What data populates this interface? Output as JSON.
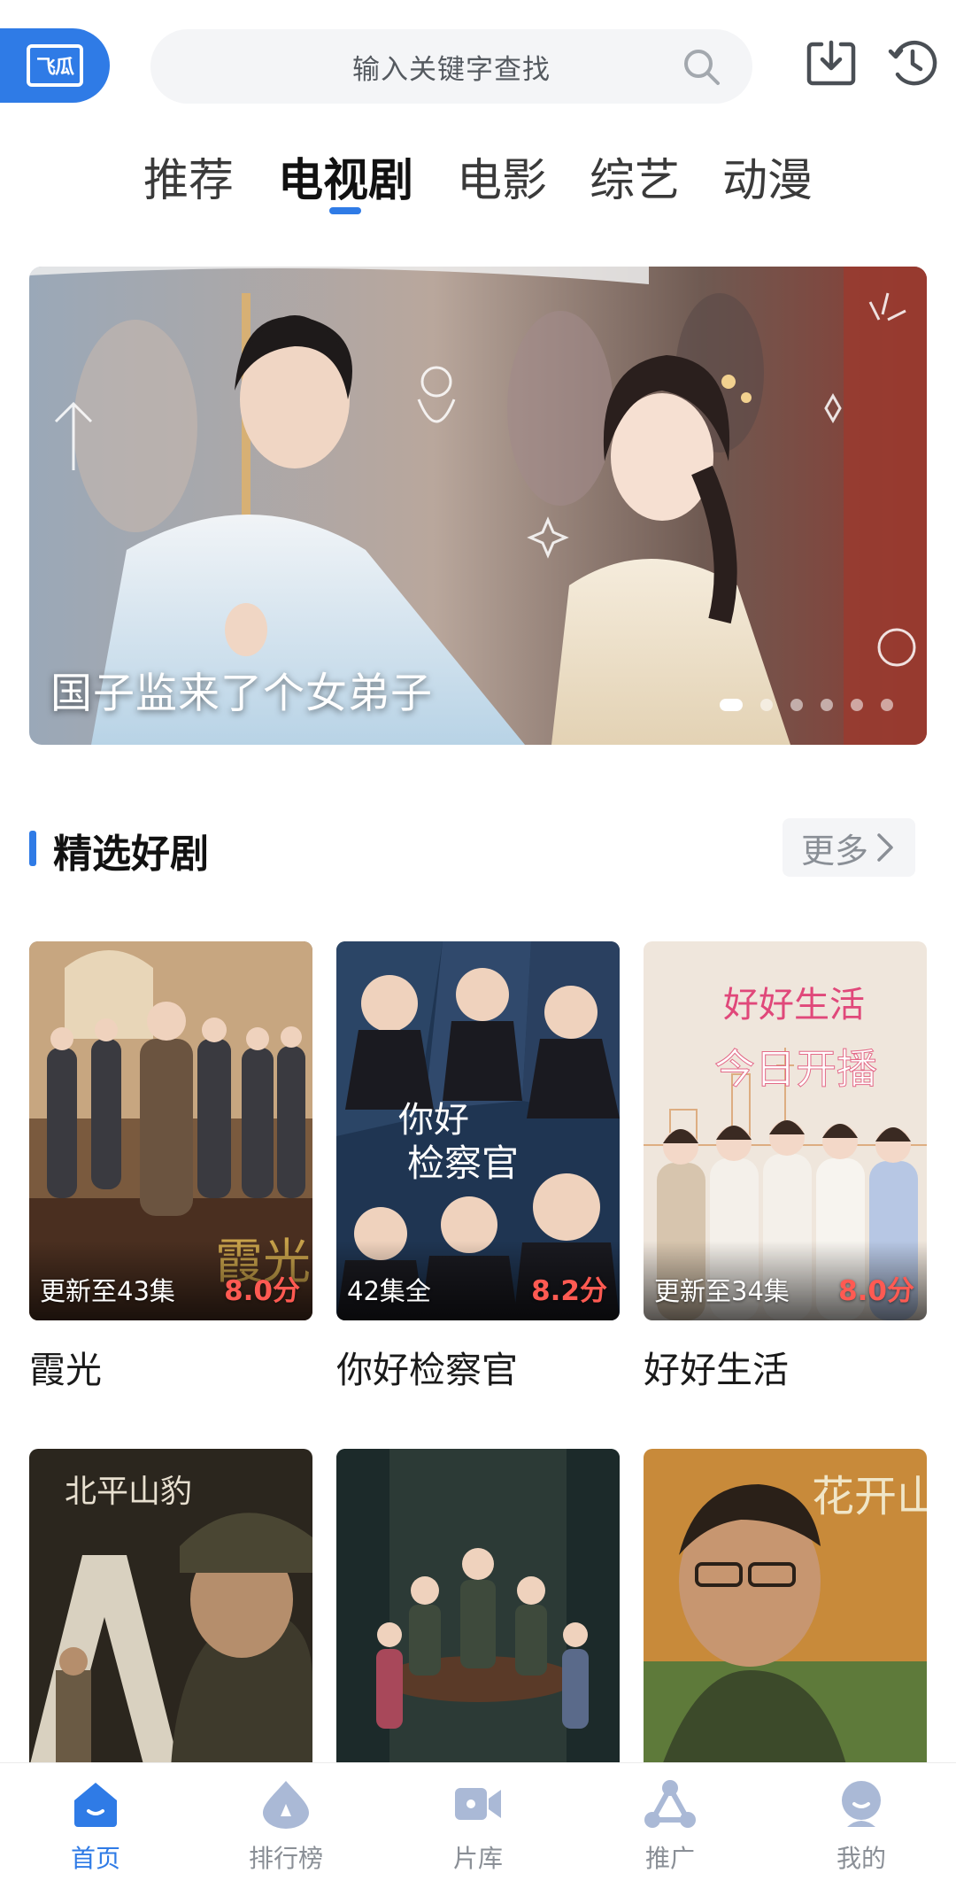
{
  "app": {
    "logo_text": "飞瓜",
    "search_placeholder": "输入关键字查找"
  },
  "tabs": [
    {
      "label": "推荐",
      "active": false
    },
    {
      "label": "电视剧",
      "active": true
    },
    {
      "label": "电影",
      "active": false
    },
    {
      "label": "综艺",
      "active": false
    },
    {
      "label": "动漫",
      "active": false
    }
  ],
  "banner": {
    "title": "国子监来了个女弟子",
    "slide_count": 6,
    "active_slide": 1
  },
  "section": {
    "title": "精选好剧",
    "more_label": "更多"
  },
  "shows": [
    {
      "title": "霞光",
      "episodes": "更新至43集",
      "score": "8.0分"
    },
    {
      "title": "你好检察官",
      "episodes": "42集全",
      "score": "8.2分"
    },
    {
      "title": "好好生活",
      "episodes": "更新至34集",
      "score": "8.0分"
    }
  ],
  "shows_row2": [
    {
      "title": "",
      "poster_text": "北平山豹"
    },
    {
      "title": "",
      "poster_text": ""
    },
    {
      "title": "",
      "poster_text": "花开山乡"
    }
  ],
  "bottom_nav": [
    {
      "label": "首页",
      "icon": "home-icon",
      "active": true
    },
    {
      "label": "排行榜",
      "icon": "ranking-icon",
      "active": false
    },
    {
      "label": "片库",
      "icon": "video-library-icon",
      "active": false
    },
    {
      "label": "推广",
      "icon": "share-icon",
      "active": false
    },
    {
      "label": "我的",
      "icon": "profile-icon",
      "active": false
    }
  ],
  "colors": {
    "accent": "#2f7be6",
    "score": "#ff5a52",
    "muted": "#8a8f96"
  }
}
